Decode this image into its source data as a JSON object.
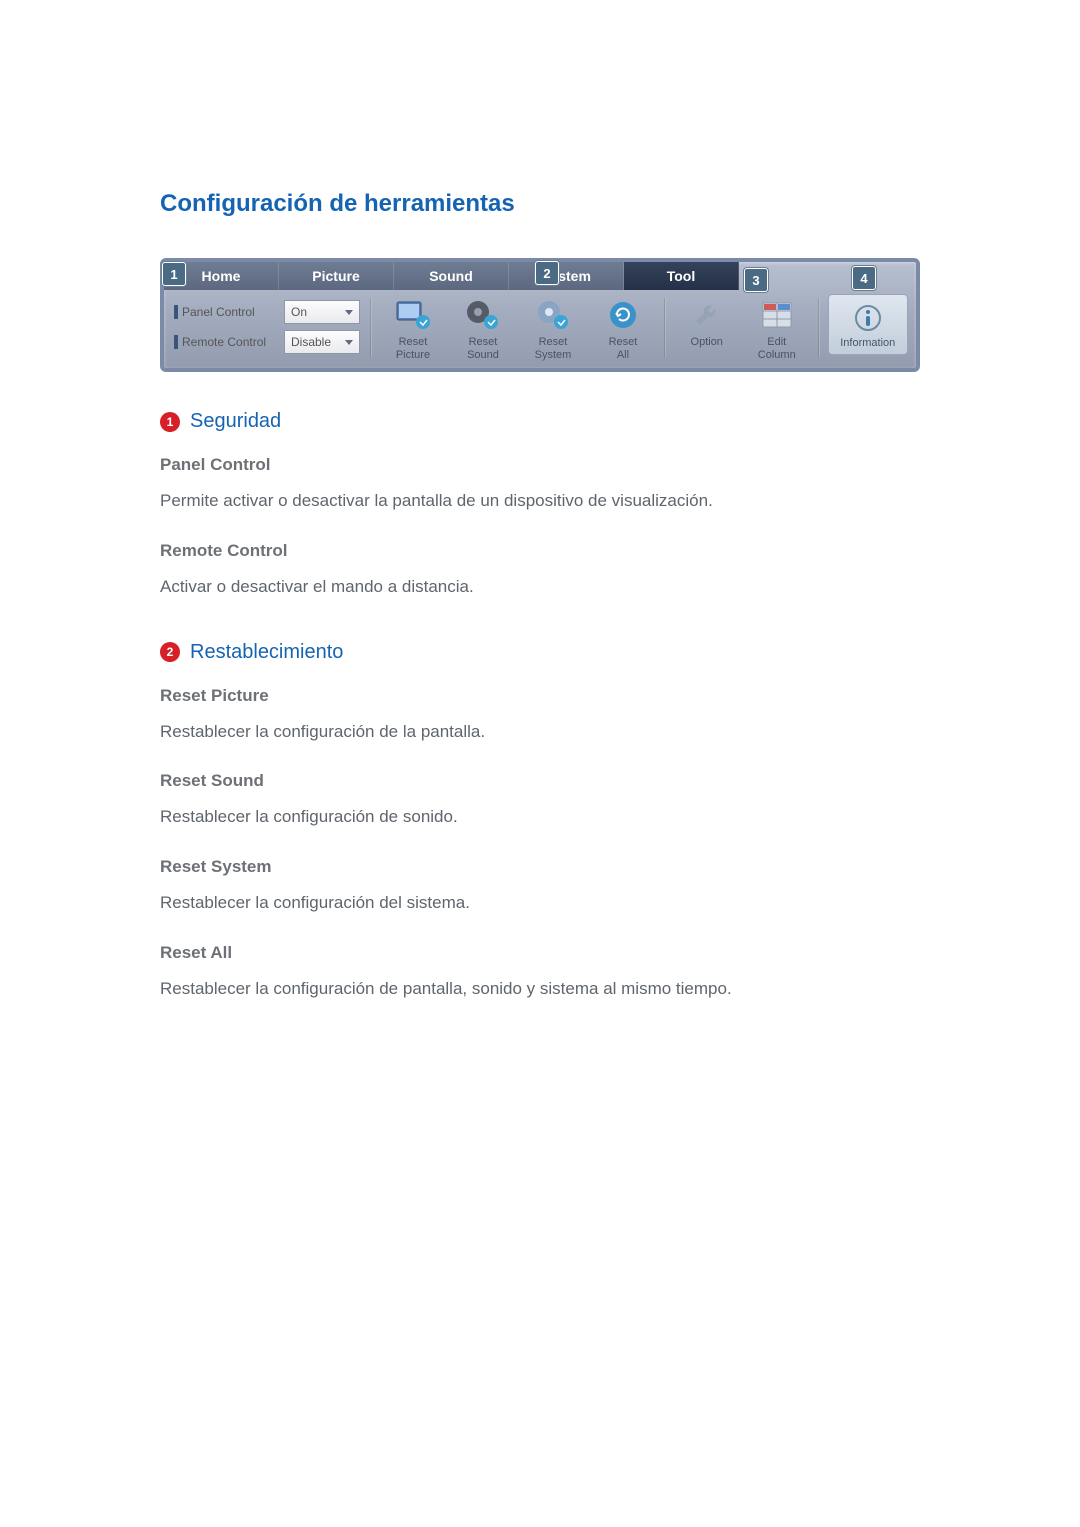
{
  "title": "Configuración de herramientas",
  "tabs": [
    "Home",
    "Picture",
    "Sound",
    "System",
    "Tool"
  ],
  "active_tab_index": 4,
  "markers": {
    "m1": "1",
    "m2": "2",
    "m3": "3",
    "m4": "4"
  },
  "security": {
    "panel_label": "Panel Control",
    "panel_value": "On",
    "remote_label": "Remote Control",
    "remote_value": "Disable"
  },
  "reset_group": [
    {
      "l1": "Reset",
      "l2": "Picture"
    },
    {
      "l1": "Reset",
      "l2": "Sound"
    },
    {
      "l1": "Reset",
      "l2": "System"
    },
    {
      "l1": "Reset",
      "l2": "All"
    }
  ],
  "util_group": [
    {
      "l1": "Option",
      "l2": ""
    },
    {
      "l1": "Edit",
      "l2": "Column"
    }
  ],
  "info_btn": "Information",
  "sections": [
    {
      "num": "1",
      "title": "Seguridad",
      "items": [
        {
          "sub": "Panel Control",
          "text": "Permite activar o desactivar la pantalla de un dispositivo de visualización."
        },
        {
          "sub": "Remote Control",
          "text": "Activar o desactivar el mando a distancia."
        }
      ]
    },
    {
      "num": "2",
      "title": "Restablecimiento",
      "items": [
        {
          "sub": "Reset Picture",
          "text": "Restablecer la configuración de la pantalla."
        },
        {
          "sub": "Reset Sound",
          "text": "Restablecer la configuración de sonido."
        },
        {
          "sub": "Reset System",
          "text": "Restablecer la configuración del sistema."
        },
        {
          "sub": "Reset All",
          "text": "Restablecer la configuración de pantalla, sonido y sistema al mismo tiempo."
        }
      ]
    }
  ]
}
